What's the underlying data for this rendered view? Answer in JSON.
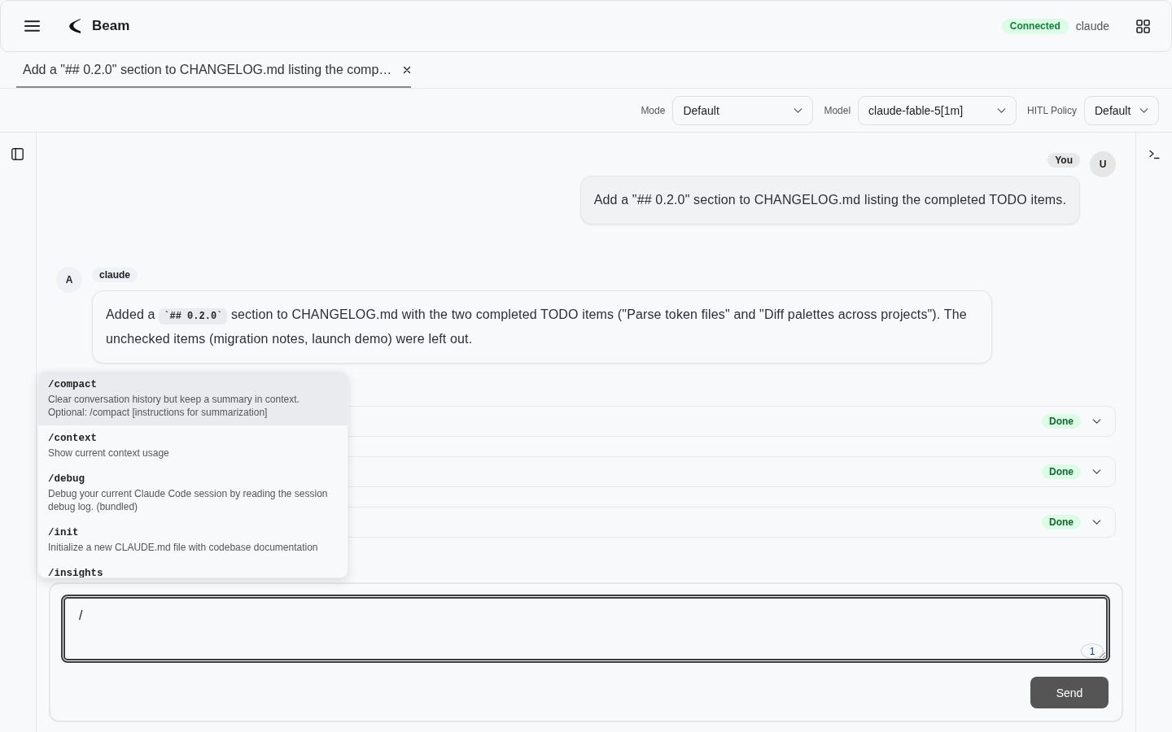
{
  "header": {
    "app_name": "Beam",
    "connection": "Connected",
    "user": "claude"
  },
  "tabs": [
    {
      "title": "Add a \"## 0.2.0\" section to CHANGELOG.md listing the comp…",
      "selected": true
    }
  ],
  "toolbar": {
    "selects": [
      {
        "label": "Mode",
        "value": "Default"
      },
      {
        "label": "Model",
        "value": "claude-fable-5[1m]"
      },
      {
        "label": "HITL Policy",
        "value": "Default"
      }
    ]
  },
  "messages": [
    {
      "kind": "user",
      "author": "You",
      "avatar": "U",
      "segments": [
        {
          "kind": "text",
          "text": "Add a \"## 0.2.0\" section to CHANGELOG.md listing the completed TODO items."
        }
      ]
    },
    {
      "kind": "assistant",
      "author": "claude",
      "avatar": "A",
      "segments": [
        {
          "kind": "text",
          "text": "Added a "
        },
        {
          "kind": "code",
          "text": "`## 0.2.0`"
        },
        {
          "kind": "text",
          "text": " section to CHANGELOG.md with the two completed TODO items (\"Parse token files\" and \"Diff palettes across projects\"). The unchecked items (migration notes, launch demo) were left out."
        }
      ]
    }
  ],
  "tool_rows": [
    {
      "status": "Done",
      "expanded": false
    },
    {
      "status": "Done",
      "expanded": false
    },
    {
      "status": "Done",
      "expanded": false
    }
  ],
  "command_menu": [
    {
      "command": "/compact",
      "description": "Clear conversation history but keep a summary in context. Optional: /compact [instructions for summarization]",
      "selected": true
    },
    {
      "command": "/context",
      "description": "Show current context usage",
      "selected": false
    },
    {
      "command": "/debug",
      "description": "Debug your current Claude Code session by reading the session debug log. (bundled)",
      "selected": false
    },
    {
      "command": "/init",
      "description": "Initialize a new CLAUDE.md file with codebase documentation",
      "selected": false
    },
    {
      "command": "/insights",
      "selected": false
    }
  ],
  "composer": {
    "value": "/",
    "counter": "1",
    "send_label": "Send"
  }
}
